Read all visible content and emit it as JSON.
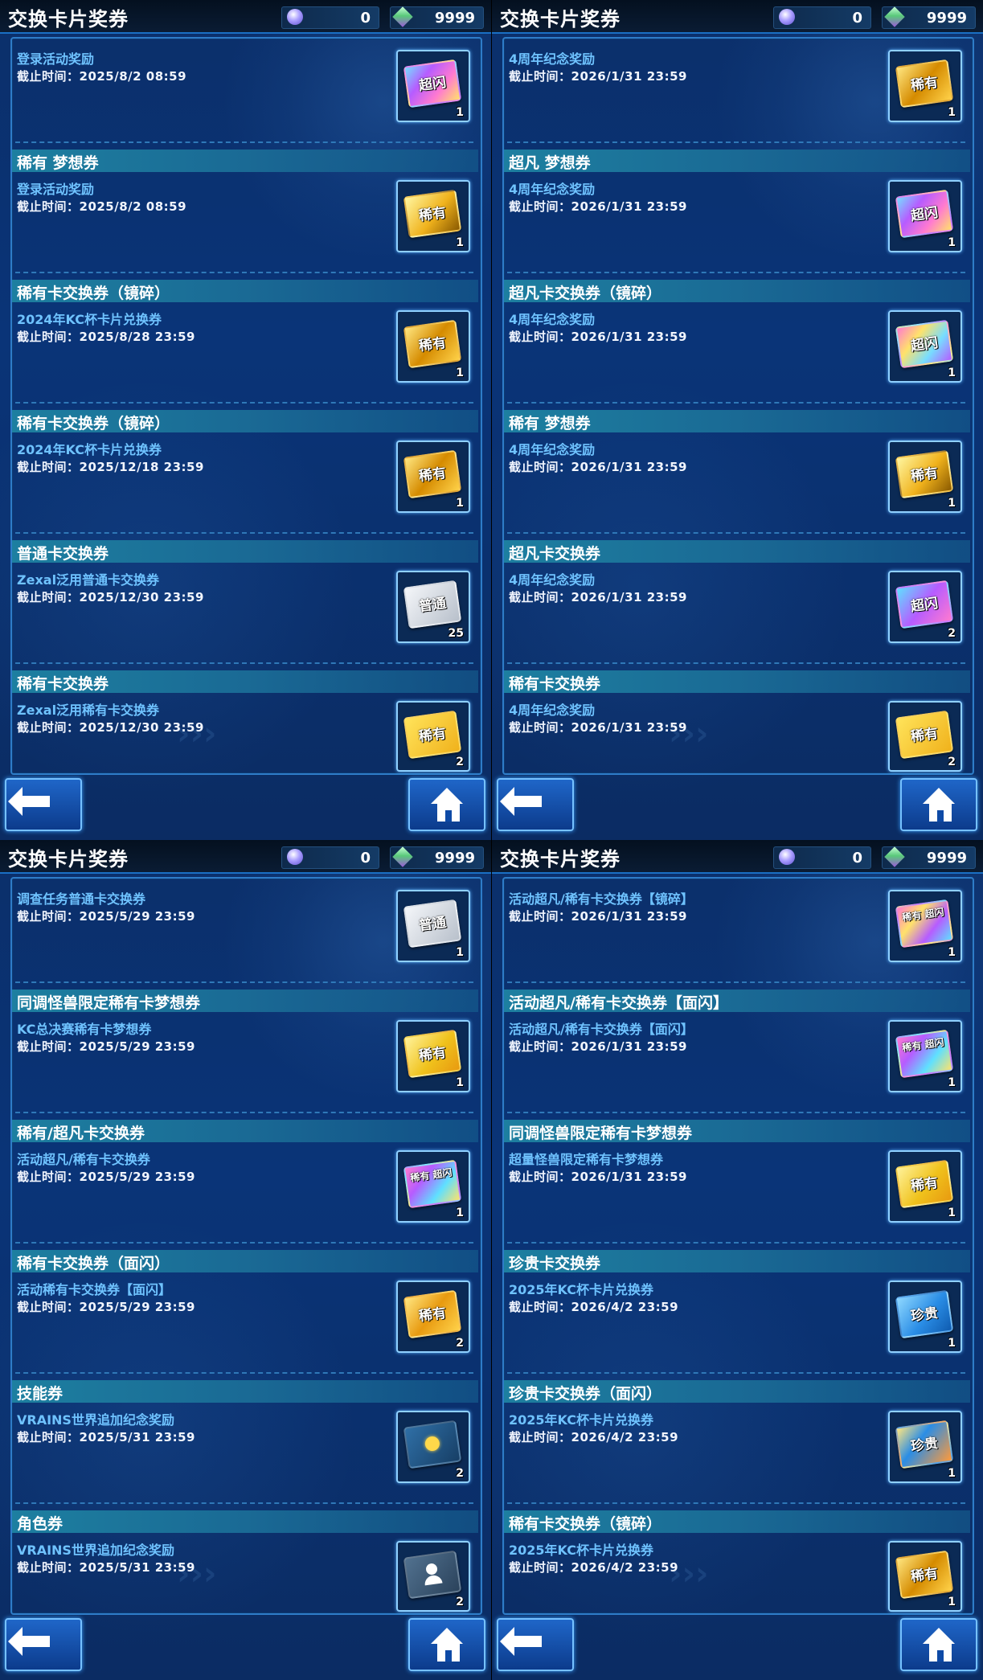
{
  "panels": [
    {
      "title": "交换卡片奖券",
      "currency": {
        "orbs": "0",
        "gems": "9999"
      },
      "items": [
        {
          "header": "",
          "name": "登录活动奖励",
          "deadline": "截止时间：2025/8/2 08:59",
          "ticket": {
            "label": "超闪",
            "kind": "ultra-dragon",
            "qty": "1"
          }
        },
        {
          "header": "稀有 梦想券",
          "name": "登录活动奖励",
          "deadline": "截止时间：2025/8/2 08:59",
          "ticket": {
            "label": "稀有",
            "kind": "rare-dragon",
            "qty": "1"
          }
        },
        {
          "header": "稀有卡交换券（镜碎）",
          "name": "2024年KC杯卡片兑换券",
          "deadline": "截止时间：2025/8/28 23:59",
          "ticket": {
            "label": "稀有",
            "kind": "rare-shatter",
            "qty": "1"
          }
        },
        {
          "header": "稀有卡交换券（镜碎）",
          "name": "2024年KC杯卡片兑换券",
          "deadline": "截止时间：2025/12/18 23:59",
          "ticket": {
            "label": "稀有",
            "kind": "rare-shatter",
            "qty": "1"
          }
        },
        {
          "header": "普通卡交换券",
          "name": "Zexal泛用普通卡交换券",
          "deadline": "截止时间：2025/12/30 23:59",
          "ticket": {
            "label": "普通",
            "kind": "normal",
            "qty": "25"
          }
        },
        {
          "header": "稀有卡交换券",
          "name": "Zexal泛用稀有卡交换券",
          "deadline": "截止时间：2025/12/30 23:59",
          "ticket": {
            "label": "稀有",
            "kind": "rare",
            "qty": "2"
          }
        }
      ]
    },
    {
      "title": "交换卡片奖券",
      "currency": {
        "orbs": "0",
        "gems": "9999"
      },
      "items": [
        {
          "header": "",
          "name": "4周年纪念奖励",
          "deadline": "截止时间：2026/1/31 23:59",
          "ticket": {
            "label": "稀有",
            "kind": "rare-shatter",
            "qty": "1"
          }
        },
        {
          "header": "超凡 梦想券",
          "name": "4周年纪念奖励",
          "deadline": "截止时间：2026/1/31 23:59",
          "ticket": {
            "label": "超闪",
            "kind": "ultra-dragon",
            "qty": "1"
          }
        },
        {
          "header": "超凡卡交换券（镜碎）",
          "name": "4周年纪念奖励",
          "deadline": "截止时间：2026/1/31 23:59",
          "ticket": {
            "label": "超闪",
            "kind": "ultra-shatter",
            "qty": "1"
          }
        },
        {
          "header": "稀有 梦想券",
          "name": "4周年纪念奖励",
          "deadline": "截止时间：2026/1/31 23:59",
          "ticket": {
            "label": "稀有",
            "kind": "rare-dragon",
            "qty": "1"
          }
        },
        {
          "header": "超凡卡交换券",
          "name": "4周年纪念奖励",
          "deadline": "截止时间：2026/1/31 23:59",
          "ticket": {
            "label": "超闪",
            "kind": "ultra",
            "qty": "2"
          }
        },
        {
          "header": "稀有卡交换券",
          "name": "4周年纪念奖励",
          "deadline": "截止时间：2026/1/31 23:59",
          "ticket": {
            "label": "稀有",
            "kind": "rare",
            "qty": "2"
          }
        }
      ]
    },
    {
      "title": "交换卡片奖券",
      "currency": {
        "orbs": "0",
        "gems": "9999"
      },
      "items": [
        {
          "header": "",
          "name": "调查任务普通卡交换券",
          "deadline": "截止时间：2025/5/29 23:59",
          "ticket": {
            "label": "普通",
            "kind": "normal",
            "qty": "1"
          }
        },
        {
          "header": "同调怪兽限定稀有卡梦想券",
          "name": "KC总决赛稀有卡梦想券",
          "deadline": "截止时间：2025/5/29 23:59",
          "ticket": {
            "label": "稀有",
            "kind": "rare-monster",
            "qty": "1"
          }
        },
        {
          "header": "稀有/超凡卡交换券",
          "name": "活动超凡/稀有卡交换券",
          "deadline": "截止时间：2025/5/29 23:59",
          "ticket": {
            "label": "稀有 超闪",
            "kind": "rare-ultra",
            "qty": "1"
          }
        },
        {
          "header": "稀有卡交换券（面闪）",
          "name": "活动稀有卡交换券【面闪】",
          "deadline": "截止时间：2025/5/29 23:59",
          "ticket": {
            "label": "稀有",
            "kind": "rare-shatter",
            "qty": "2"
          }
        },
        {
          "header": "技能券",
          "name": "VRAINS世界追加纪念奖励",
          "deadline": "截止时间：2025/5/31 23:59",
          "ticket": {
            "label": "",
            "kind": "skill",
            "qty": "2"
          }
        },
        {
          "header": "角色券",
          "name": "VRAINS世界追加纪念奖励",
          "deadline": "截止时间：2025/5/31 23:59",
          "ticket": {
            "label": "",
            "kind": "character",
            "qty": "2"
          }
        }
      ]
    },
    {
      "title": "交换卡片奖券",
      "currency": {
        "orbs": "0",
        "gems": "9999"
      },
      "items": [
        {
          "header": "",
          "name": "活动超凡/稀有卡交换券【镜碎】",
          "deadline": "截止时间：2026/1/31 23:59",
          "ticket": {
            "label": "稀有 超闪",
            "kind": "rare-ultra",
            "qty": "1"
          }
        },
        {
          "header": "活动超凡/稀有卡交换券【面闪】",
          "name": "活动超凡/稀有卡交换券【面闪】",
          "deadline": "截止时间：2026/1/31 23:59",
          "ticket": {
            "label": "稀有 超闪",
            "kind": "rare-ultra",
            "qty": "1"
          }
        },
        {
          "header": "同调怪兽限定稀有卡梦想券",
          "name": "超量怪兽限定稀有卡梦想券",
          "deadline": "截止时间：2026/1/31 23:59",
          "ticket": {
            "label": "稀有",
            "kind": "rare-monster",
            "qty": "1"
          }
        },
        {
          "header": "珍贵卡交换券",
          "name": "2025年KC杯卡片兑换券",
          "deadline": "截止时间：2026/4/2 23:59",
          "ticket": {
            "label": "珍贵",
            "kind": "precious",
            "qty": "1"
          }
        },
        {
          "header": "珍贵卡交换券（面闪）",
          "name": "2025年KC杯卡片兑换券",
          "deadline": "截止时间：2026/4/2 23:59",
          "ticket": {
            "label": "珍贵",
            "kind": "precious-foil",
            "qty": "1"
          }
        },
        {
          "header": "稀有卡交换券（镜碎）",
          "name": "2025年KC杯卡片兑换券",
          "deadline": "截止时间：2026/4/2 23:59",
          "ticket": {
            "label": "稀有",
            "kind": "rare-shatter",
            "qty": "1"
          }
        }
      ]
    }
  ],
  "colors": {
    "normal": "#c9ced6",
    "rare": "#f0b21c",
    "ultra": "#b65cff",
    "precious": "#2a8de6",
    "skill": "#1e4f7a",
    "character": "#3a5a78"
  }
}
